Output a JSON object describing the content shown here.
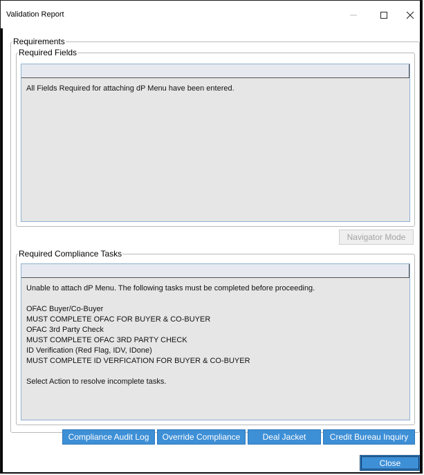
{
  "window": {
    "title": "Validation Report"
  },
  "requirements": {
    "legend": "Requirements",
    "required_fields": {
      "legend": "Required Fields",
      "lines": [
        "All Fields Required for attaching dP Menu have been entered."
      ]
    },
    "navigator_mode_label": "Navigator Mode",
    "compliance_tasks": {
      "legend": "Required Compliance Tasks",
      "lines": [
        "Unable to attach dP Menu. The following tasks must be completed before proceeding.",
        "",
        "OFAC Buyer/Co-Buyer",
        "MUST COMPLETE OFAC FOR BUYER & CO-BUYER",
        "OFAC 3rd Party Check",
        "MUST COMPLETE OFAC 3RD PARTY CHECK",
        "ID Verification (Red Flag, IDV, IDone)",
        "MUST COMPLETE ID VERFICATION FOR BUYER & CO-BUYER",
        "",
        "Select Action to resolve incomplete tasks."
      ]
    }
  },
  "actions": {
    "compliance_audit_log": "Compliance Audit Log",
    "override_compliance": "Override Compliance",
    "deal_jacket": "Deal Jacket",
    "credit_bureau_inquiry": "Credit Bureau Inquiry"
  },
  "footer": {
    "close_label": "Close"
  },
  "colors": {
    "button_blue": "#3d8fd6",
    "listbox_bg": "#e6e6e6",
    "listbox_border": "#8fb0cf"
  },
  "icons": {
    "minimize": "minimize-icon",
    "maximize": "maximize-icon",
    "close": "close-icon"
  }
}
